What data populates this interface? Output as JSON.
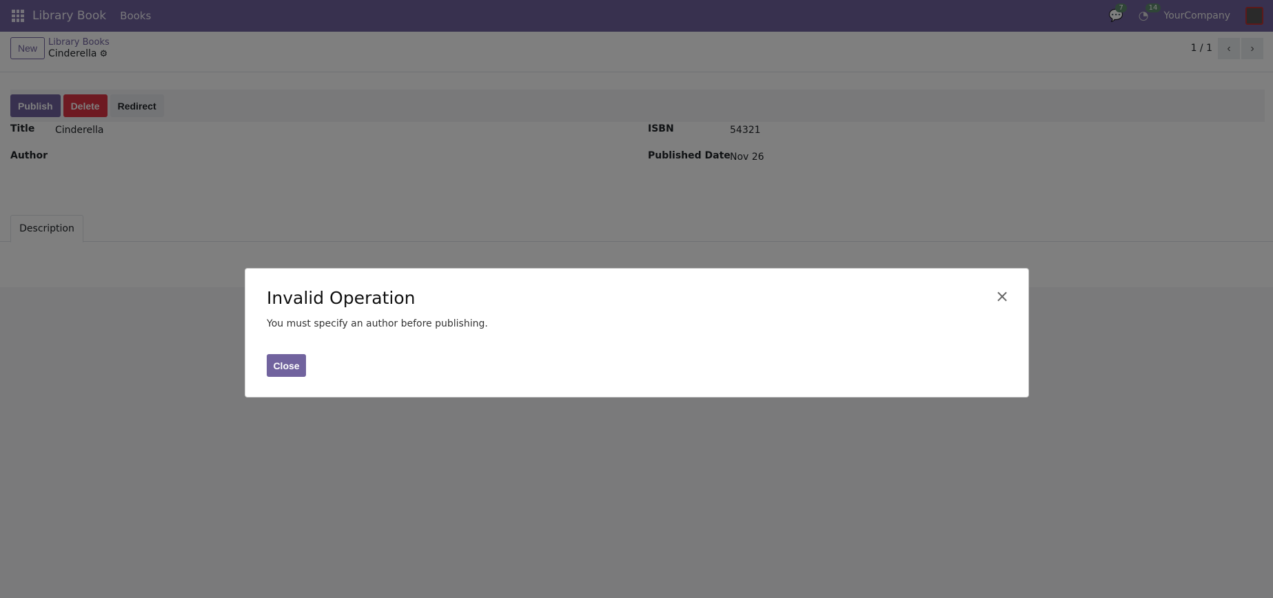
{
  "navbar": {
    "app_name": "Library Book",
    "menu_books": "Books",
    "messages_count": "7",
    "activities_count": "14",
    "company": "YourCompany"
  },
  "control_panel": {
    "new_label": "New",
    "breadcrumb_parent": "Library Books",
    "breadcrumb_current": "Cinderella",
    "pager": "1 / 1"
  },
  "statusbar": {
    "publish": "Publish",
    "delete": "Delete",
    "redirect": "Redirect"
  },
  "fields": {
    "title_label": "Title",
    "title_value": "Cinderella",
    "author_label": "Author",
    "isbn_label": "ISBN",
    "isbn_value": "54321",
    "published_label": "Published Date",
    "published_value": "Nov 26"
  },
  "tabs": {
    "description": "Description"
  },
  "dialog": {
    "title": "Invalid Operation",
    "message": "You must specify an author before publishing.",
    "close_label": "Close",
    "close_icon": "×"
  },
  "colors": {
    "brand": "#71639e",
    "danger": "#dc3545"
  }
}
